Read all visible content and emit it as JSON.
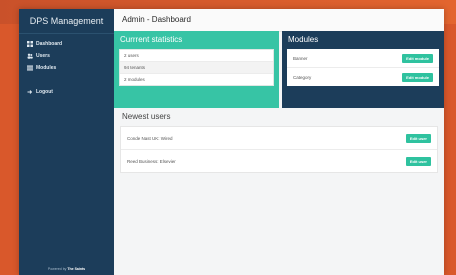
{
  "app": {
    "title": "DPS Management"
  },
  "sidebar": {
    "items": [
      {
        "label": "Dashboard",
        "icon": "dashboard-icon"
      },
      {
        "label": "Users",
        "icon": "users-icon"
      },
      {
        "label": "Modules",
        "icon": "modules-icon"
      }
    ],
    "logout": {
      "label": "Logout",
      "icon": "logout-arrow-icon"
    },
    "footer_prefix": "Powered by",
    "footer_brand": "The Saints"
  },
  "header": {
    "title": "Admin - Dashboard"
  },
  "stats": {
    "title": "Currrent statistics",
    "items": [
      "2 users",
      "94 tenants",
      "2 modules"
    ]
  },
  "modules": {
    "title": "Modules",
    "items": [
      {
        "name": "Banner",
        "button": "Edit module"
      },
      {
        "name": "Category",
        "button": "Edit module"
      }
    ]
  },
  "newest_users": {
    "title": "Newest users",
    "items": [
      {
        "name": "Conde Nast UK: Wired",
        "button": "Edit user"
      },
      {
        "name": "Reed Business: Elsevier",
        "button": "Edit user"
      }
    ]
  },
  "colors": {
    "accent": "#37c4a5",
    "sidebar": "#1c3d5a",
    "button": "#2fc29f",
    "background": "#d9582b"
  }
}
